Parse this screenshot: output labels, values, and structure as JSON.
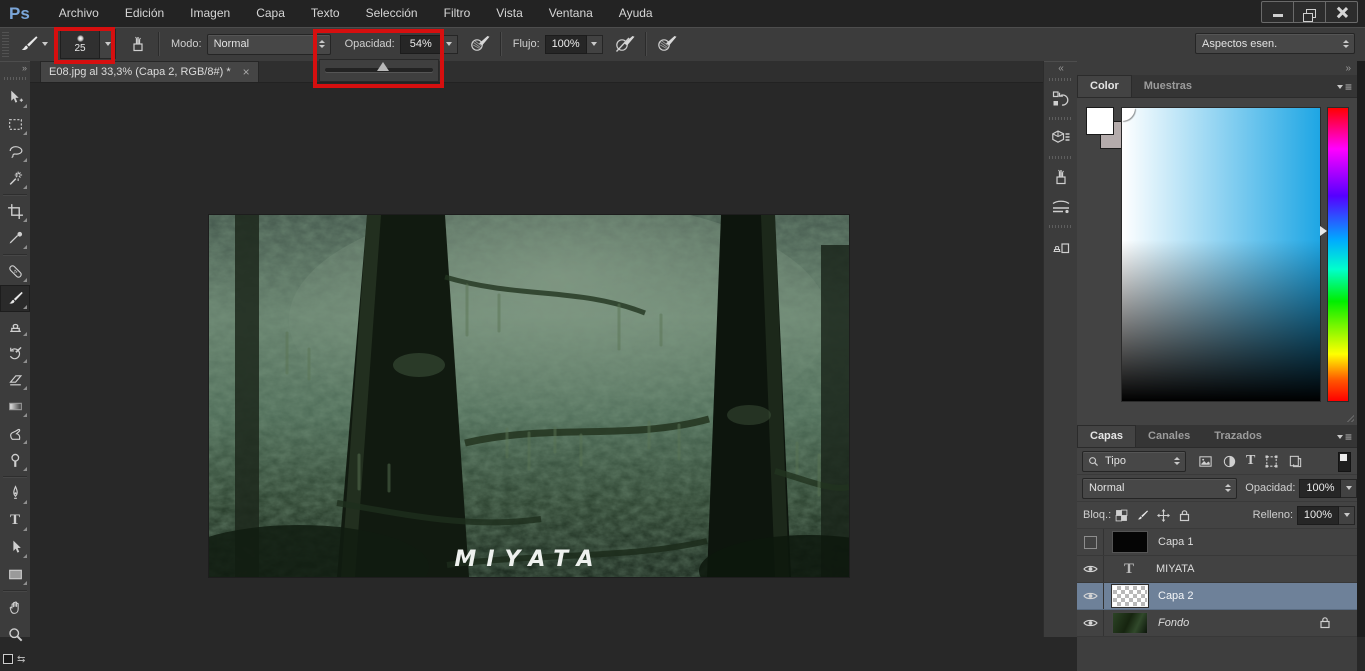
{
  "titlebar": {
    "logo": "Ps",
    "menus": [
      "Archivo",
      "Edición",
      "Imagen",
      "Capa",
      "Texto",
      "Selección",
      "Filtro",
      "Vista",
      "Ventana",
      "Ayuda"
    ]
  },
  "options_bar": {
    "brush_size": "25",
    "modo_label": "Modo:",
    "modo_value": "Normal",
    "opacidad_label": "Opacidad:",
    "opacidad_value": "54%",
    "opacity_slider_percent": 54,
    "flujo_label": "Flujo:",
    "flujo_value": "100%",
    "workspace": "Aspectos esen."
  },
  "document_tab": {
    "title": "E08.jpg al 33,3% (Capa 2, RGB/8#) *"
  },
  "canvas": {
    "overlay_text": "MIYATA"
  },
  "toolbar": {
    "tools": [
      "move",
      "rectangular-marquee",
      "lasso",
      "magic-wand",
      "crop",
      "eyedropper",
      "spot-healing-brush",
      "brush",
      "clone-stamp",
      "history-brush",
      "eraser",
      "gradient",
      "smudge",
      "dodge",
      "pen",
      "type",
      "path-selection",
      "rectangle-shape",
      "hand",
      "zoom"
    ],
    "selected_tool": "brush"
  },
  "dock": {
    "icons": [
      "history",
      "properties",
      "brush-settings",
      "brush-presets",
      "clone-source"
    ]
  },
  "color_panel": {
    "tabs": [
      "Color",
      "Muestras"
    ],
    "active_tab": "Color"
  },
  "layers_panel": {
    "tabs": [
      "Capas",
      "Canales",
      "Trazados"
    ],
    "active_tab": "Capas",
    "filter_label": "Tipo",
    "blend_mode": "Normal",
    "opacidad_label": "Opacidad:",
    "opacidad_value": "100%",
    "bloq_label": "Bloq.:",
    "relleno_label": "Relleno:",
    "relleno_value": "100%",
    "layers": [
      {
        "name": "Capa 1",
        "visible": false,
        "selected": false,
        "type": "pixel-black"
      },
      {
        "name": "MIYATA",
        "visible": true,
        "selected": false,
        "type": "text"
      },
      {
        "name": "Capa 2",
        "visible": true,
        "selected": true,
        "type": "transparent"
      },
      {
        "name": "Fondo",
        "visible": true,
        "selected": false,
        "type": "image-locked"
      }
    ]
  },
  "icons": {
    "collapse_dock": "«",
    "expand_dock": "»",
    "toolbar_expand": "»",
    "tab_close": "×",
    "panel_menu": "≡",
    "type_glyph": "T",
    "swap_glyph": "⇆"
  },
  "annotation": {
    "highlight_color": "#d60f0f"
  }
}
